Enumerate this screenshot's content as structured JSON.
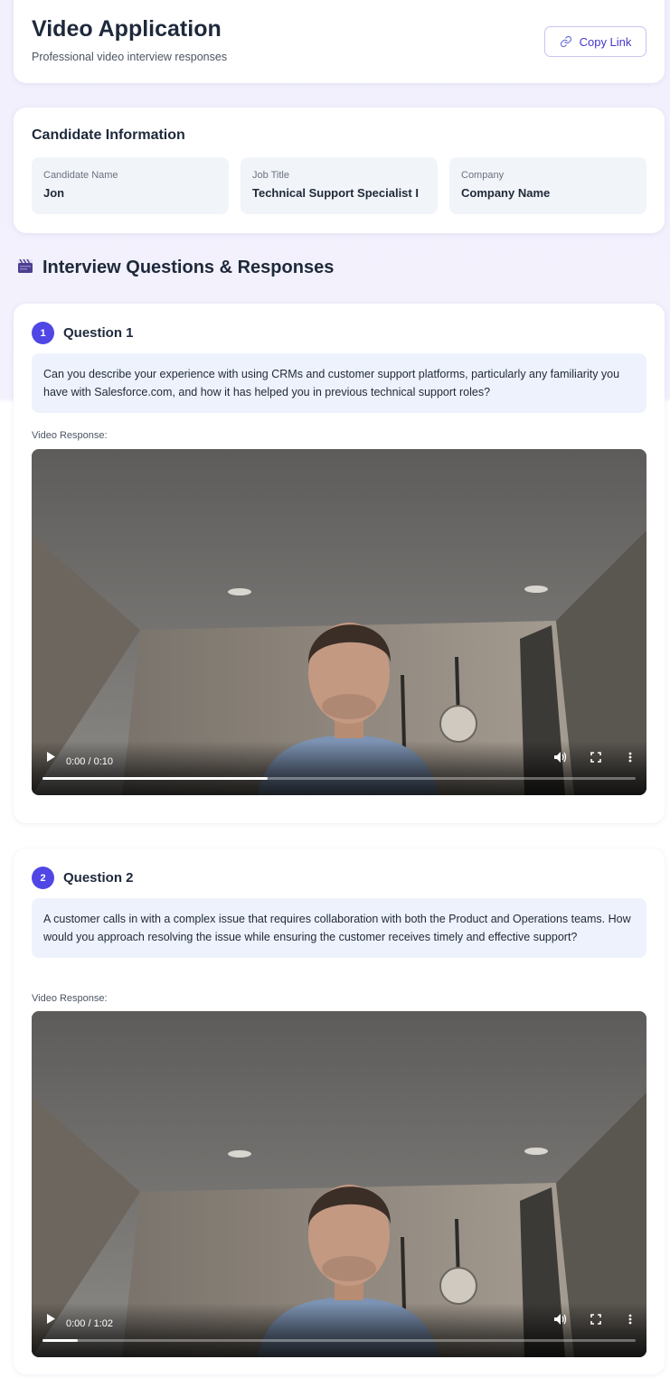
{
  "header": {
    "title": "Video Application",
    "subtitle": "Professional video interview responses",
    "copy_label": "Copy Link",
    "copy_icon": "link-icon"
  },
  "candidate": {
    "section_title": "Candidate Information",
    "fields": [
      {
        "label": "Candidate Name",
        "value": "Jon"
      },
      {
        "label": "Job Title",
        "value": "Technical Support Specialist I"
      },
      {
        "label": "Company",
        "value": "Company Name"
      }
    ]
  },
  "interview": {
    "icon": "clapperboard-icon",
    "title": "Interview Questions & Responses",
    "questions": [
      {
        "number": "1",
        "label": "Question 1",
        "text": "Can you describe your experience with using CRMs and customer support platforms, particularly any familiarity you have with Salesforce.com, and how it has helped you in previous technical support roles?",
        "video_label": "Video Response:",
        "time": "0:00 / 0:10",
        "progress_buffered": 0.38
      },
      {
        "number": "2",
        "label": "Question 2",
        "text": "A customer calls in with a complex issue that requires collaboration with both the Product and Operations teams. How would you approach resolving the issue while ensuring the customer receives timely and effective support?",
        "video_label": "Video Response:",
        "time": "0:00 / 1:02",
        "progress_buffered": 0.06
      }
    ]
  }
}
